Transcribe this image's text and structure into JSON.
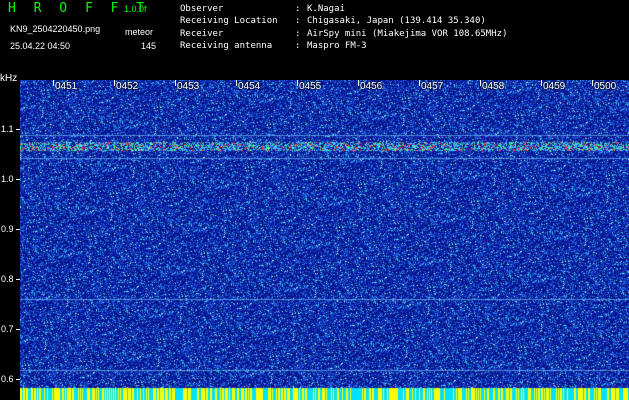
{
  "header": {
    "app_title": "H R O F F T",
    "version": "1.0.0f",
    "file_name": "KN9_2504220450.png",
    "mode": "meteor",
    "timestamp": "25.04.22 04:50",
    "count": "145",
    "info": [
      {
        "key": "Observer",
        "sep": ":",
        "value": "K.Nagai"
      },
      {
        "key": "Receiving Location",
        "sep": ":",
        "value": "Chigasaki, Japan (139.414 35.340)"
      },
      {
        "key": "Receiver",
        "sep": ":",
        "value": "AirSpy mini (Miakejima VOR 108.65MHz)"
      },
      {
        "key": "Receiving antenna",
        "sep": ":",
        "value": "Maspro FM-3"
      }
    ]
  },
  "axis": {
    "unit": "kHz",
    "y_ticks": [
      "1.1",
      "1.0",
      "0.9",
      "0.8",
      "0.7",
      "0.6"
    ],
    "x_ticks": [
      "0451",
      "0452",
      "0453",
      "0454",
      "0455",
      "0456",
      "0457",
      "0458",
      "0459",
      "0500"
    ]
  },
  "colors": {
    "background": "#000000",
    "title_green": "#00ff00",
    "noise_base": "#1a2fa0",
    "signal_red": "#ff3030",
    "baseline_yellow": "#ffff00",
    "baseline_cyan": "#00e0ff"
  }
}
